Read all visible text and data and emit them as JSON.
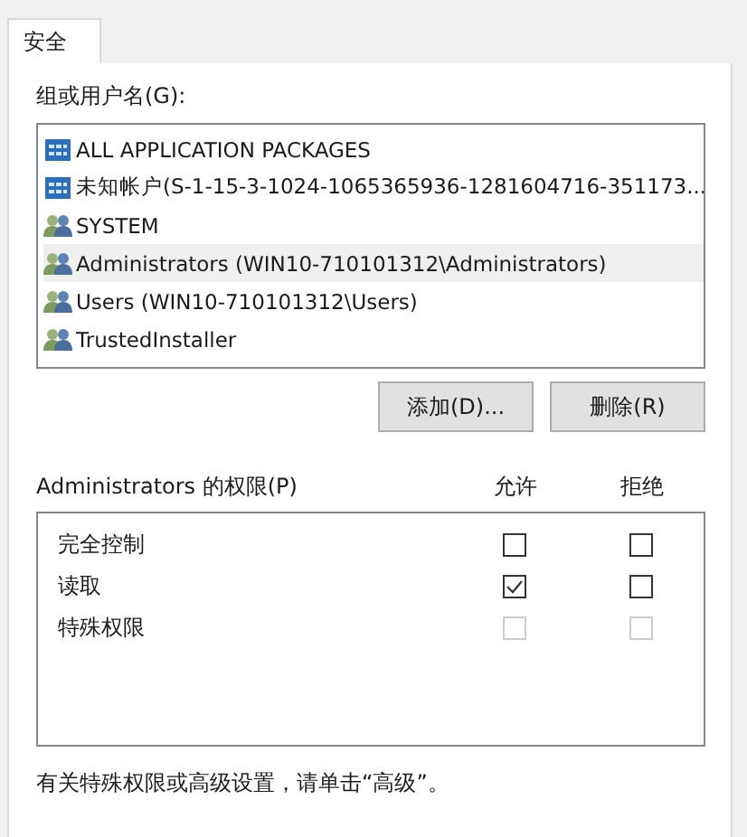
{
  "tabs": [
    {
      "label": "安全",
      "selected": true
    }
  ],
  "group_label": "组或用户名(G):",
  "principals": [
    {
      "kind": "package",
      "name": "ALL APPLICATION PACKAGES",
      "selected": false
    },
    {
      "kind": "package",
      "name": "未知帐户(S-1-15-3-1024-1065365936-1281604716-351173...",
      "selected": false
    },
    {
      "kind": "group",
      "name": "SYSTEM",
      "selected": false
    },
    {
      "kind": "group",
      "name": "Administrators (WIN10-710101312\\Administrators)",
      "selected": true
    },
    {
      "kind": "group",
      "name": "Users (WIN10-710101312\\Users)",
      "selected": false
    },
    {
      "kind": "group",
      "name": "TrustedInstaller",
      "selected": false
    }
  ],
  "buttons": [
    "添加(D)...",
    "删除(R)"
  ],
  "permissions_label": "Administrators 的权限(P)",
  "columns": [
    "允许",
    "拒绝"
  ],
  "permissions": [
    {
      "name": "完全控制",
      "allow": {
        "checked": false,
        "disabled": false
      },
      "deny": {
        "checked": false,
        "disabled": false
      }
    },
    {
      "name": "读取",
      "allow": {
        "checked": true,
        "disabled": false
      },
      "deny": {
        "checked": false,
        "disabled": false
      }
    },
    {
      "name": "特殊权限",
      "allow": {
        "checked": false,
        "disabled": true
      },
      "deny": {
        "checked": false,
        "disabled": true
      }
    }
  ],
  "footer": "有关特殊权限或高级设置，请单击“高级”。"
}
